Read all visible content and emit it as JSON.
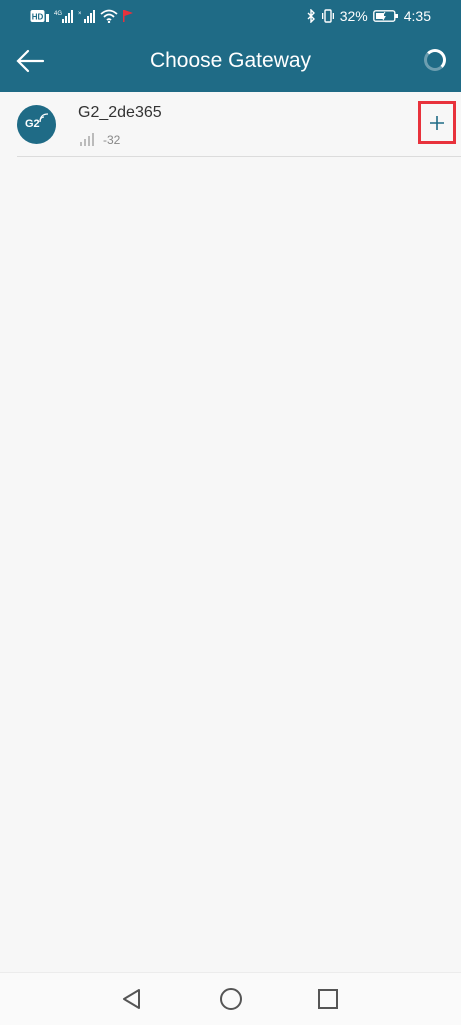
{
  "status_bar": {
    "time": "4:35",
    "battery_percent": "32%",
    "left_icons": [
      "hd-icon",
      "4g-signal-icon",
      "signal-icon",
      "wifi-icon",
      "flag-icon"
    ],
    "right_icons": [
      "bluetooth-icon",
      "vibrate-icon",
      "battery-icon"
    ]
  },
  "app_bar": {
    "title": "Choose Gateway",
    "back_icon": "back-arrow-icon",
    "loading_icon": "spinner-icon"
  },
  "gateways": [
    {
      "name": "G2_2de365",
      "avatar_label": "G2",
      "signal_value": "-32",
      "action_icon": "plus-icon"
    }
  ],
  "nav_bar": {
    "icons": [
      "nav-back-icon",
      "nav-home-icon",
      "nav-recent-icon"
    ]
  },
  "colors": {
    "primary": "#1f6b86",
    "highlight": "#e8323c",
    "background": "#f7f7f7"
  }
}
